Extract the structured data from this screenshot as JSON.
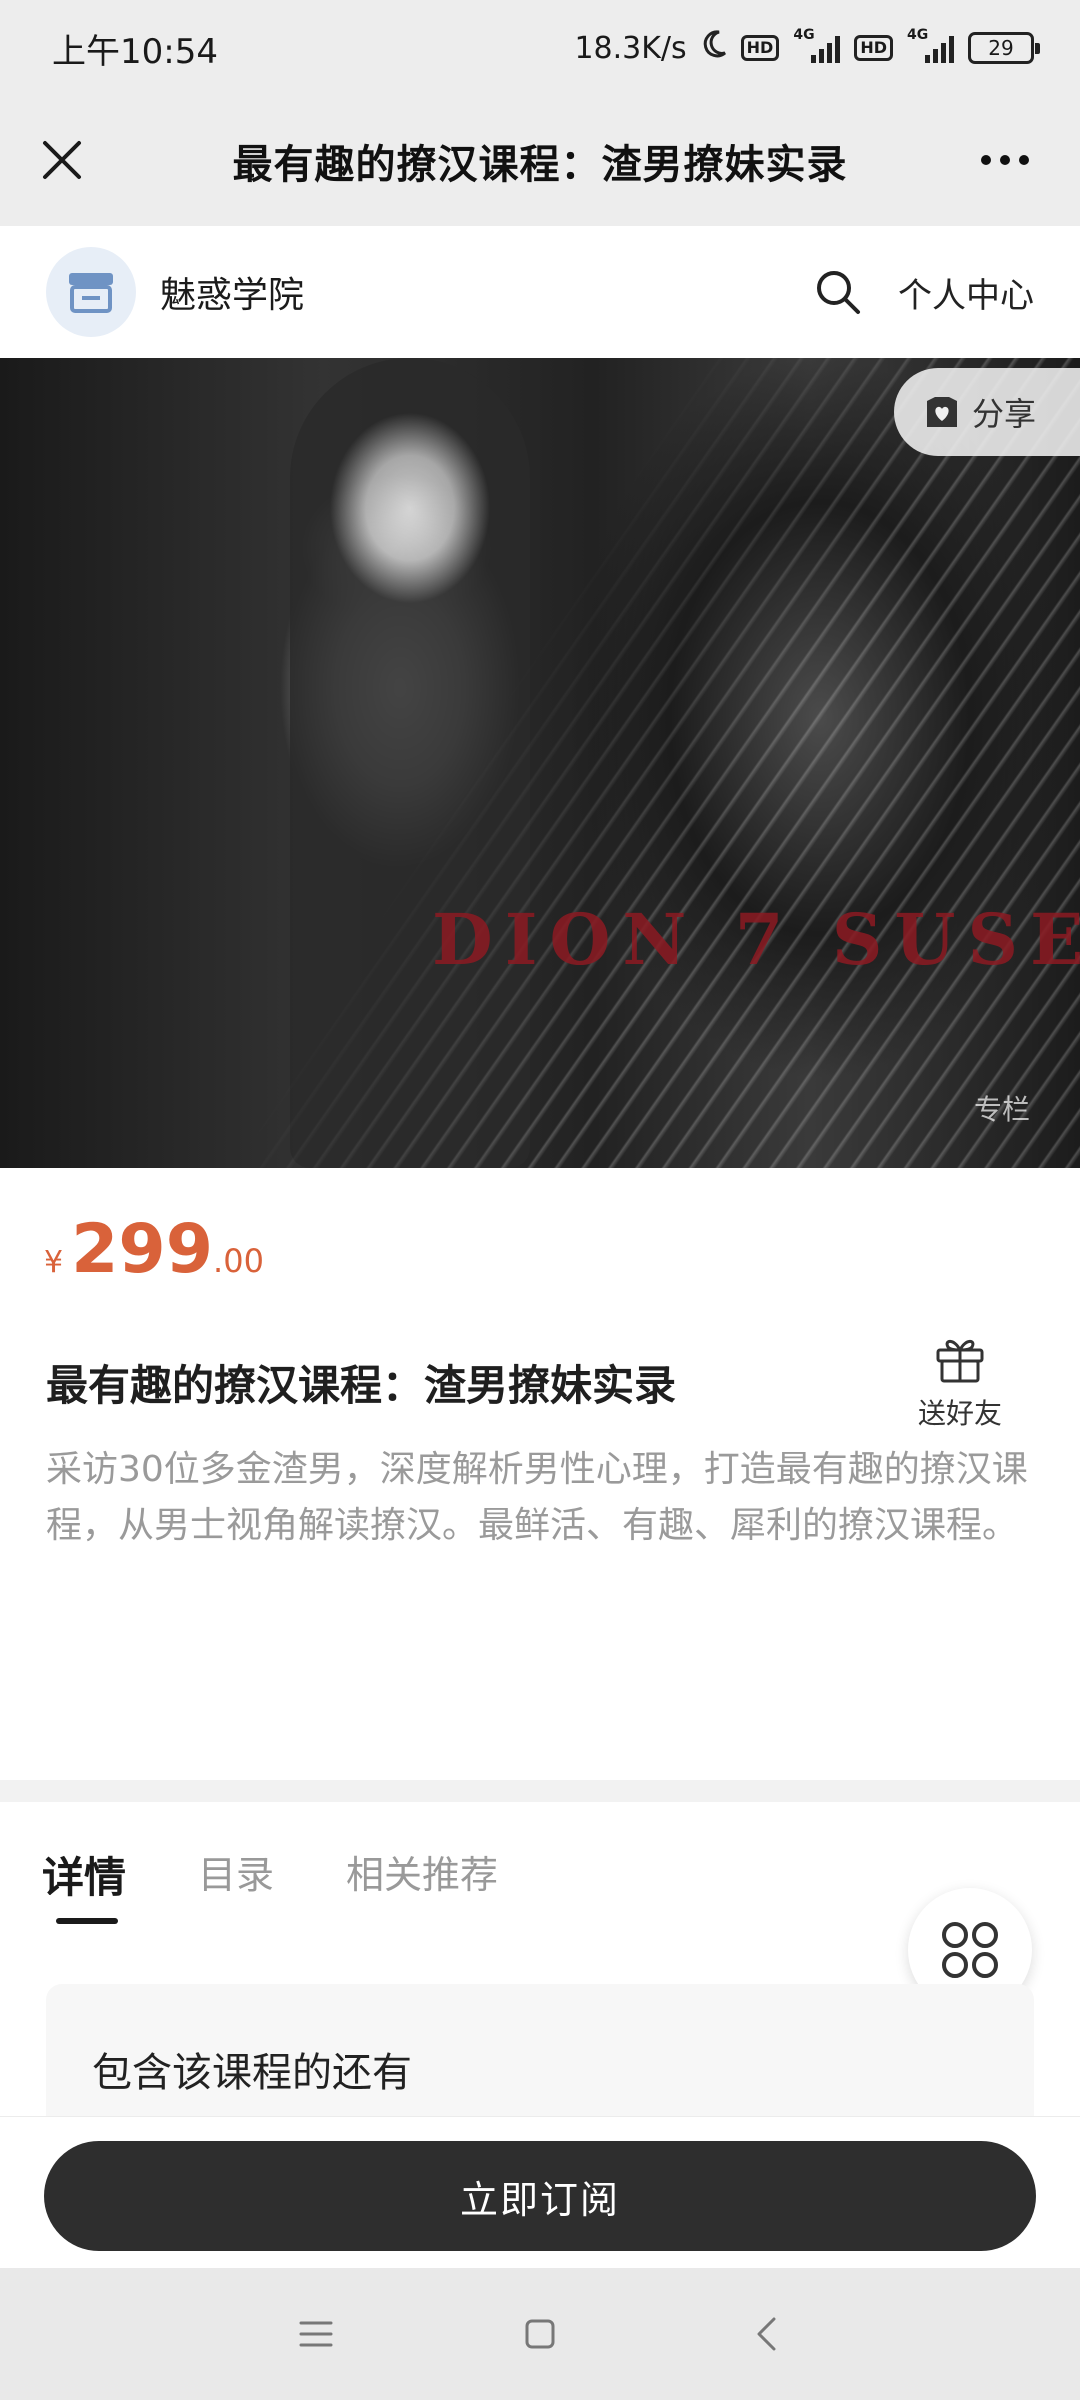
{
  "status_bar": {
    "time": "上午10:54",
    "network_speed": "18.3K/s",
    "hd_badge": "HD",
    "network_type": "4G",
    "battery": "29"
  },
  "title_bar": {
    "title": "最有趣的撩汉课程：渣男撩妹实录"
  },
  "shop": {
    "name": "魅惑学院",
    "personal_center": "个人中心"
  },
  "banner": {
    "overlay_text": "DION 7 SUSE",
    "share_label": "分享",
    "column_tag": "专栏"
  },
  "product": {
    "currency": "¥",
    "price_int": "299",
    "price_dec": ".00",
    "title": "最有趣的撩汉课程：渣男撩妹实录",
    "gift_label": "送好友",
    "description": "采访30位多金渣男，深度解析男性心理，打造最有趣的撩汉课程，从男士视角解读撩汉。最鲜活、有趣、犀利的撩汉课程。"
  },
  "tabs": [
    {
      "label": "详情",
      "active": true
    },
    {
      "label": "目录",
      "active": false
    },
    {
      "label": "相关推荐",
      "active": false
    }
  ],
  "includes": {
    "label": "包含该课程的还有"
  },
  "action": {
    "subscribe_label": "立即订阅"
  },
  "colors": {
    "price": "#d9623a",
    "button_bg": "#2e2e2e",
    "page_bg": "#ffffff",
    "bar_bg": "#ededed"
  }
}
